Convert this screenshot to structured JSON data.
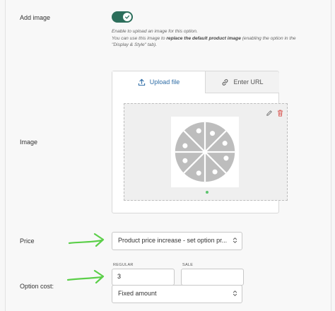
{
  "add_image": {
    "label": "Add image",
    "toggle_on": true,
    "help_line1": "Enable to upload an image for this option.",
    "help_line2_prefix": "You can use this image to ",
    "help_line2_bold": "replace the default product image",
    "help_line2_suffix": " (enabling the option in the",
    "help_line3": "\"Display & Style\" tab)."
  },
  "image": {
    "label": "Image",
    "tabs": [
      {
        "label": "Upload file",
        "icon": "upload-icon",
        "active": true
      },
      {
        "label": "Enter URL",
        "icon": "link-icon",
        "active": false
      }
    ]
  },
  "price": {
    "label": "Price",
    "selected": "Product price increase - set option pr..."
  },
  "option_cost": {
    "label": "Option cost:",
    "regular_label": "REGULAR",
    "regular_value": "3",
    "sale_label": "SALE",
    "sale_value": "",
    "type_selected": "Fixed amount"
  },
  "colors": {
    "toggle": "#2c6e5b",
    "tab_active_text": "#2f6da6",
    "annotation_arrow": "#5ccf4a",
    "placeholder_gray": "#bdbdbd"
  }
}
